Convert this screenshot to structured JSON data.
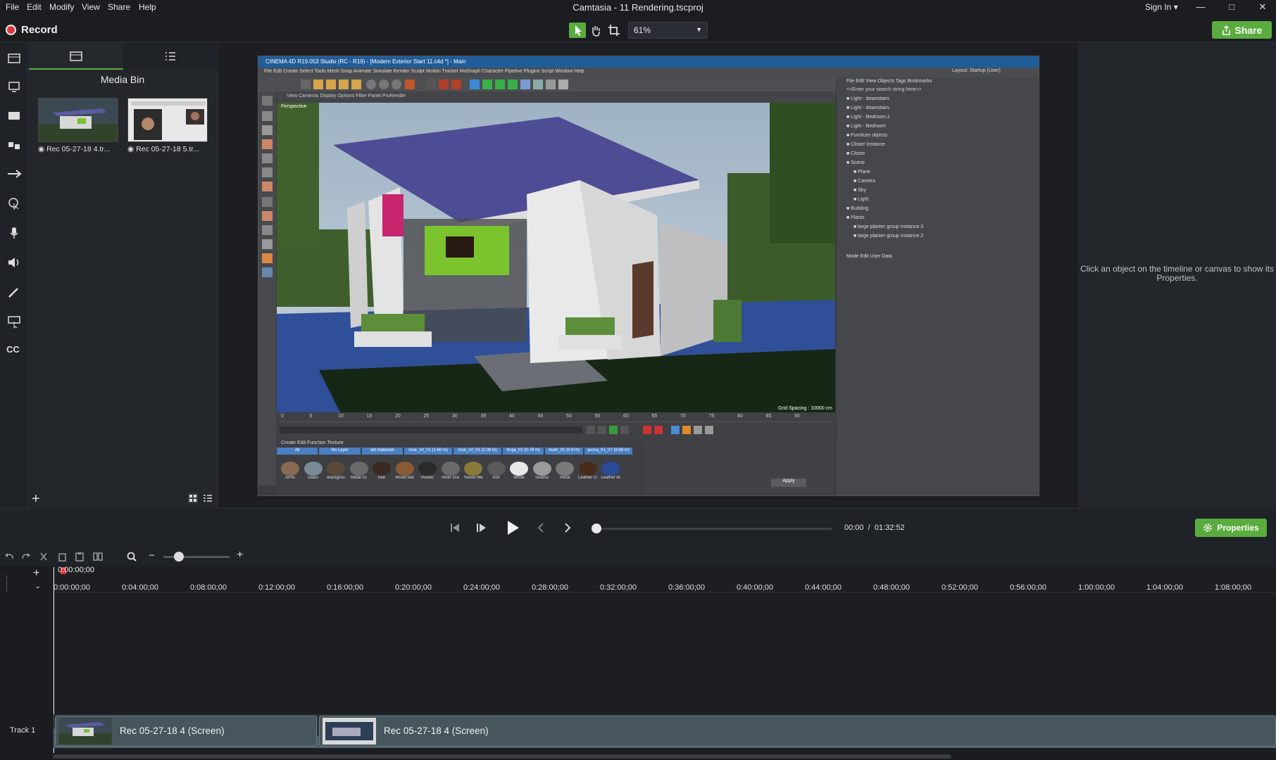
{
  "window": {
    "title": "Camtasia - 11 Rendering.tscproj",
    "menu": [
      "File",
      "Edit",
      "Modify",
      "View",
      "Share",
      "Help"
    ],
    "sign_in": "Sign In ▾"
  },
  "toolbar": {
    "record_label": "Record",
    "zoom_value": "61%",
    "share_label": "Share"
  },
  "media_bin": {
    "title": "Media Bin",
    "items": [
      {
        "label": "Rec 05-27-18 4.tr..."
      },
      {
        "label": "Rec 05-27-18 5.tr..."
      }
    ]
  },
  "canvas": {
    "c4d_title": "CINEMA 4D R19.053 Studio (RC - R19) - [Modern Exterior Start 11.c4d *] - Main",
    "c4d_menu": "File   Edit   Create   Select   Tools   Mesh   Snap   Animate   Simulate   Render   Sculpt   Motion Tracker   MoGraph   Character   Pipeline   Plugins   Script   Window   Help",
    "c4d_layout": "Layout:  Startup (User)",
    "object_menu": "File   Edit   View   Objects   Tags   Bookmarks",
    "object_search": "<<Enter your search string here>>",
    "objects": [
      "Light - downstairs",
      "Light - downstairs",
      "Light - Bedroom.1",
      "Light - Bedroom",
      "Furniture objects",
      "Closer Instance",
      "Closer",
      "Scene",
      "Plane",
      "Camera",
      "Sky",
      "Light",
      "Building",
      "Plants",
      "large planter group Instance.3",
      "large planter group Instance.2"
    ],
    "attr_menu": "Mode   Edit   User Data",
    "timeline_ticks": [
      "0",
      "5",
      "10",
      "15",
      "20",
      "25",
      "30",
      "35",
      "40",
      "45",
      "50",
      "55",
      "60",
      "65",
      "70",
      "75",
      "80",
      "85",
      "90"
    ],
    "materials_menu": "Create   Edit   Function   Texture",
    "material_tabs": [
      "All",
      "No Layer",
      "old materials",
      "rose_14_01 (1.60 m)",
      "rose_10_01 (2.08 m)",
      "thuja_01 (0.78 m)",
      "bush_01 (0.9 m)",
      "yucca_01_07 (0.69 m)"
    ],
    "materials": [
      "Arms",
      "Glass",
      "Backgrou",
      "Metal 02",
      "Mat",
      "Wood Nat",
      "Plastic",
      "Inner Dra",
      "Yellow Me",
      "Iron",
      "White",
      "Seams",
      "metal",
      "Leather O",
      "Leather Bl"
    ],
    "apply_label": "Apply",
    "grid_spacing": "Grid Spacing : 10000 cm",
    "viewport_label": "Perspective",
    "viewport_menu": "View   Cameras   Display   Options   Filter   Panel   ProRender"
  },
  "properties": {
    "hint": "Click an object on the timeline or canvas to show its Properties.",
    "button": "Properties"
  },
  "playback": {
    "current": "00:00",
    "separator": "/",
    "total": "01:32:52"
  },
  "timeline": {
    "playhead": "0:00:00;00",
    "ticks": [
      "0:00:00;00",
      "0:04:00;00",
      "0:08:00;00",
      "0:12:00;00",
      "0:16:00;00",
      "0:20:00;00",
      "0:24:00;00",
      "0:28:00;00",
      "0:32:00;00",
      "0:36:00;00",
      "0:40:00;00",
      "0:44:00;00",
      "0:48:00;00",
      "0:52:00;00",
      "0:56:00;00",
      "1:00:00;00",
      "1:04:00;00",
      "1:08:00;00"
    ],
    "track_label": "Track 1",
    "clips": [
      {
        "label": "Rec 05-27-18 4 (Screen)"
      },
      {
        "label": "Rec 05-27-18 4 (Screen)"
      }
    ]
  },
  "colors": {
    "accent": "#5aac3e",
    "record": "#e0383e",
    "background": "#1f2227"
  }
}
